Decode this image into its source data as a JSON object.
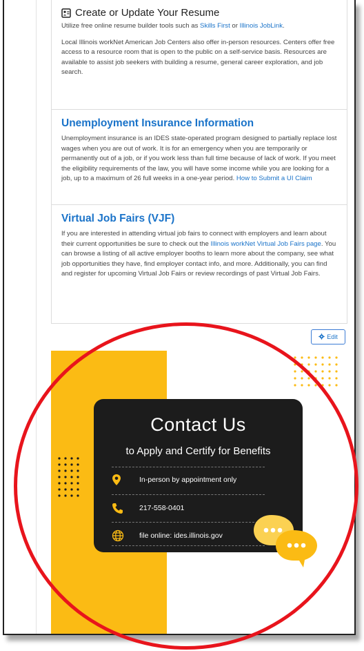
{
  "resume": {
    "title": "Create or Update Your Resume",
    "p1_prefix": "Utilize free online resume builder tools such as ",
    "link_skills_first": "Skills First",
    "p1_or": " or ",
    "link_jobLink": "Illinois JobLink",
    "p1_suffix": ".",
    "p2": "Local Illinois workNet American Job Centers also offer in-person resources. Centers offer free access to a resource room that is open to the public on a self-service basis. Resources are available to assist job seekers with building a resume, general career exploration, and job search."
  },
  "unemployment": {
    "title": "Unemployment Insurance Information",
    "p": "Unemployment insurance is an IDES state-operated program designed to partially replace lost wages when you are out of work. It is for an emergency when you are temporarily or permanently out of a job, or if you work less than full time because of lack of work. If you meet the eligibility requirements of the law, you will have some income while you are looking for a job, up to a maximum of 26 full weeks in a one-year period. ",
    "link_claim": "How to Submit a UI Claim"
  },
  "vjf": {
    "title": "Virtual Job Fairs (VJF)",
    "p_prefix": "If you are interested in attending virtual job fairs to connect with employers and learn about their current opportunities be sure to check out the ",
    "link_vjf": "Illinois workNet Virtual Job Fairs page",
    "p_suffix": ". You can browse a listing of all active employer booths to learn more about the company, see what job opportunities they have, find employer contact info, and more. Additionally, you can find and register for upcoming Virtual Job Fairs or review recordings of past Virtual Job Fairs."
  },
  "edit_button": {
    "label": "Edit"
  },
  "contact": {
    "title": "Contact Us",
    "subtitle": "to Apply and Certify for Benefits",
    "rows": [
      {
        "icon": "location-pin-icon",
        "text": "In-person by appointment only"
      },
      {
        "icon": "phone-icon",
        "text": "217-558-0401"
      },
      {
        "icon": "globe-icon",
        "text": "file online: ides.illinois.gov"
      }
    ]
  },
  "colors": {
    "accent_blue": "#1a73c9",
    "yellow": "#fbbb14",
    "card_black": "#1c1c1c",
    "annotation_red": "#e8141c"
  }
}
